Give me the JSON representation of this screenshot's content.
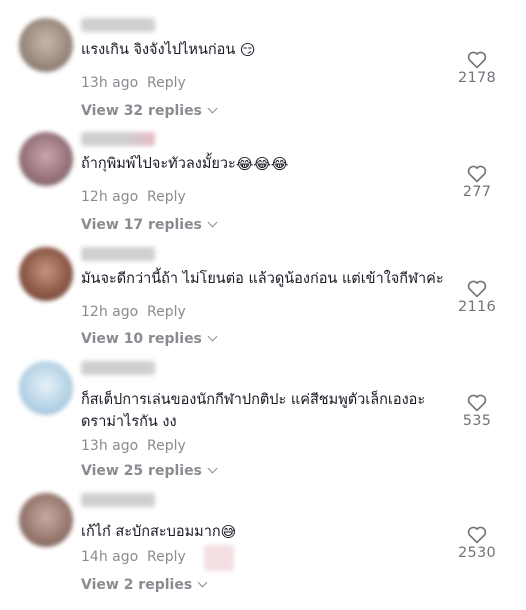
{
  "icons": {
    "like": "heart-outline-icon",
    "expand": "chevron-down-icon"
  },
  "colors": {
    "meta": "#8a8b91",
    "text": "#161823"
  },
  "comments": [
    {
      "text": "แรงเกิน จิงจังไปไหนก่อน",
      "emoji": "😏",
      "time": "13h ago",
      "reply": "Reply",
      "likes": "2178",
      "view_replies": "View 32 replies"
    },
    {
      "text": "ถ้ากุพิมพ์ไปจะทัวลงมั้ยวะ",
      "emoji": "😂😂😂",
      "time": "12h ago",
      "reply": "Reply",
      "likes": "277",
      "view_replies": "View 17 replies"
    },
    {
      "text": "มันจะดีกว่านี้ถ้า ไม่โยนต่อ แล้วดูน้องก่อน แต่เข้าใจกีฬาค่ะ",
      "emoji": "",
      "time": "12h ago",
      "reply": "Reply",
      "likes": "2116",
      "view_replies": "View 10 replies"
    },
    {
      "text": "ก็สเต็ปการเล่นของนักกีฬาปกติปะ แค่สีชมพูตัวเล็กเองอะ\nดราม่าไรกัน งง",
      "emoji": "",
      "time": "13h ago",
      "reply": "Reply",
      "likes": "535",
      "view_replies": "View 25 replies"
    },
    {
      "text": "เก้ไก๋ สะบักสะบอมมาก",
      "emoji": "😅",
      "time": "14h ago",
      "reply": "Reply",
      "likes": "2530",
      "view_replies": "View 2 replies"
    }
  ]
}
